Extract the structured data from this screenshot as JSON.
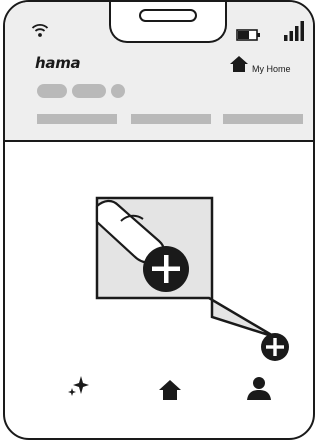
{
  "app": {
    "logo_text": "hama",
    "home_label": "My Home"
  },
  "icons": {
    "wifi": "wifi-icon",
    "battery": "battery-icon",
    "signal": "signal-icon",
    "home": "home-icon",
    "add": "plus-circle-icon",
    "finger": "finger-tap-icon",
    "sparkle": "sparkle-icon",
    "profile": "user-icon"
  },
  "colors": {
    "line": "#1a1a1a",
    "header_bg": "#eeeeee",
    "placeholder": "#b9b9b9",
    "zoom_bg": "#e4e4e4"
  }
}
